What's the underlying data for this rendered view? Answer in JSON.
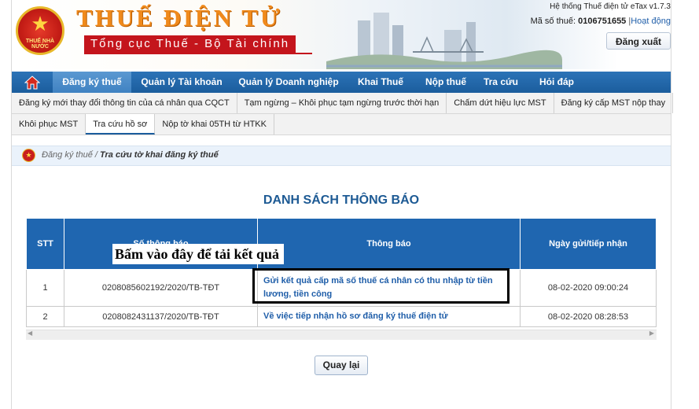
{
  "header": {
    "brand_title": "THUẾ ĐIỆN TỬ",
    "brand_subtitle": "Tổng cục Thuế - Bộ Tài chính",
    "emblem_text": "THUẾ NHÀ NƯỚC",
    "system_version": "Hệ thống Thuế điện tử eTax v1.7.3",
    "mst_label": "Mã số thuế:",
    "mst_value": "0106751655",
    "separator": "|",
    "activity_link": "Hoạt động",
    "logout_label": "Đăng xuất"
  },
  "main_nav": {
    "home_icon": "home-icon",
    "items": [
      {
        "label": "Đăng ký thuế"
      },
      {
        "label": "Quản lý Tài khoản"
      },
      {
        "label": "Quản lý Doanh nghiệp"
      },
      {
        "label": "Khai Thuế"
      },
      {
        "label": "Nộp thuế"
      },
      {
        "label": "Tra cứu"
      },
      {
        "label": "Hỏi đáp"
      }
    ],
    "active_index": 0
  },
  "sub_nav": {
    "row1": [
      {
        "label": "Đăng ký mới thay đổi thông tin của cá nhân qua CQCT"
      },
      {
        "label": "Tạm ngừng – Khôi phục tạm ngừng trước thời hạn"
      },
      {
        "label": "Chấm dứt hiệu lực MST"
      },
      {
        "label": "Đăng ký cấp MST nộp thay"
      }
    ],
    "row2": [
      {
        "label": "Khôi phục MST"
      },
      {
        "label": "Tra cứu hồ sơ"
      },
      {
        "label": "Nộp tờ khai 05TH từ HTKK"
      }
    ],
    "active": "Tra cứu hồ sơ"
  },
  "breadcrumb": {
    "parent": "Đăng ký thuế",
    "sep": " / ",
    "current": "Tra cứu tờ khai đăng ký thuế"
  },
  "page_title": "DANH SÁCH THÔNG BÁO",
  "table": {
    "headers": {
      "stt": "STT",
      "so_thong_bao": "Số thông báo",
      "thong_bao": "Thông báo",
      "ngay": "Ngày gửi/tiếp nhận"
    },
    "rows": [
      {
        "stt": "1",
        "so": "0208085602192/2020/TB-TĐT",
        "msg": "Gửi kết quả cấp mã số thuế cá nhân có thu nhập từ tiền lương, tiền công",
        "date": "08-02-2020 09:00:24"
      },
      {
        "stt": "2",
        "so": "0208082431137/2020/TB-TĐT",
        "msg": "Về việc tiếp nhận hồ sơ đăng ký thuế điện tử",
        "date": "08-02-2020 08:28:53"
      }
    ]
  },
  "annotation": {
    "label": "Bấm vào đây để tải kết quả"
  },
  "back_button": "Quay lại",
  "colors": {
    "nav": "#1b5d9d",
    "table_header": "#1f66b0",
    "link": "#1f5ea9",
    "brand_orange": "#f08a1c",
    "brand_red": "#c4151c"
  }
}
